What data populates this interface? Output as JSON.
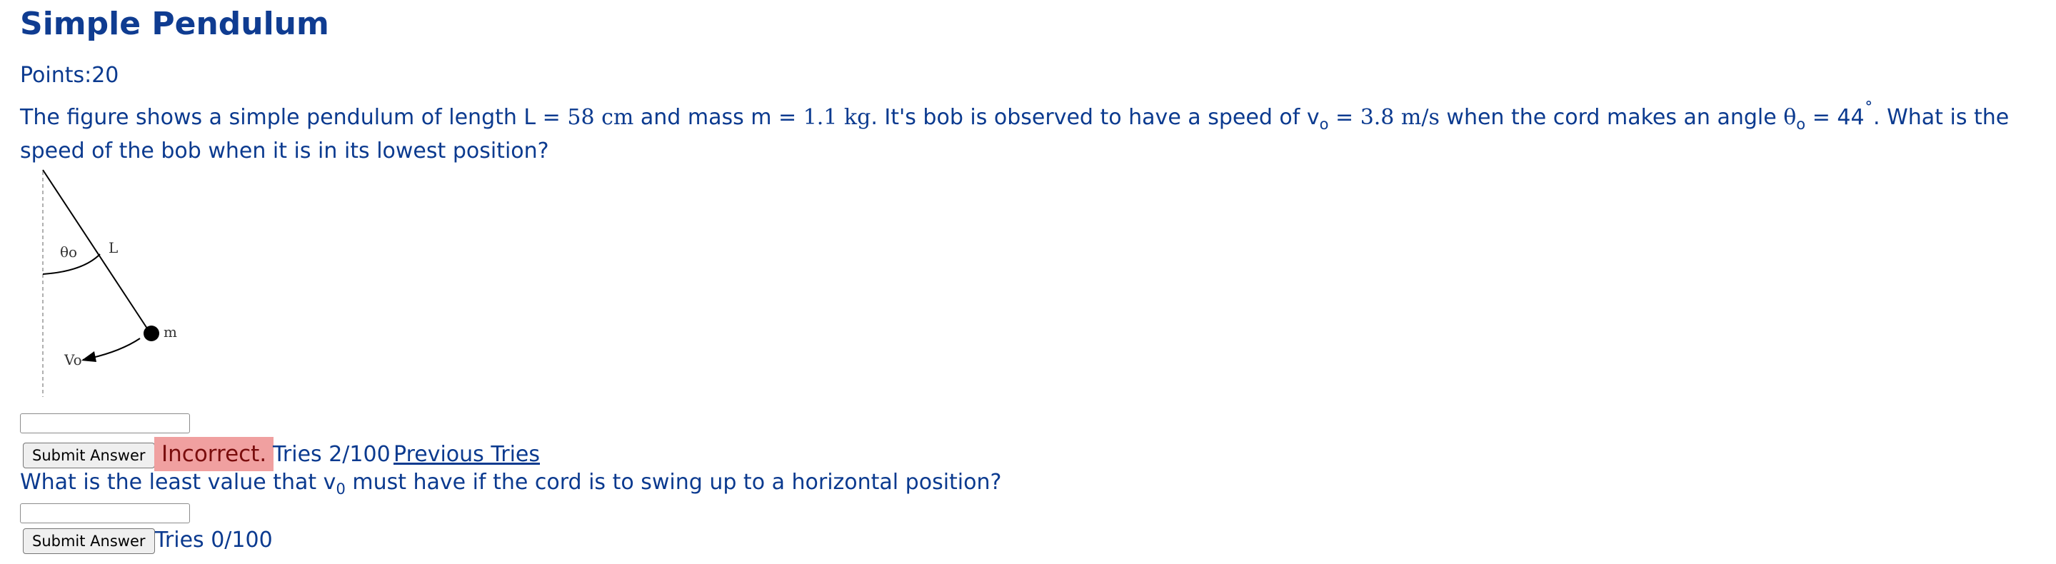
{
  "page": {
    "title": "Simple Pendulum",
    "points_label": "Points:20"
  },
  "problem1": {
    "text_a": "The figure shows a simple pendulum of length L = ",
    "length_value": "58 cm",
    "text_b": " and mass m = ",
    "mass_value": "1.1 kg",
    "text_c": ". It's bob is observed to have a speed of v",
    "v_sub": "o",
    "text_d": " = ",
    "speed_value": "3.8 m/s",
    "text_e": " when the cord makes an angle ",
    "theta_symbol": "θ",
    "theta_sub": "o",
    "text_f": " = 44",
    "degree": "˚",
    "text_g": ". What is the speed of the bob when it is in its lowest position?"
  },
  "figure": {
    "theta_label": "θo",
    "length_label": "L",
    "mass_label": "m",
    "velocity_label": "Vo"
  },
  "part1": {
    "input_value": "",
    "submit_label": "Submit Answer",
    "status": "Incorrect.",
    "tries": "Tries 2/100",
    "previous_tries_link": "Previous Tries",
    "status_color": "#f0a0a0"
  },
  "part2": {
    "question_a": "What is the least value that v",
    "question_sub": "0",
    "question_b": " must have if the cord is to swing up to a horizontal position?",
    "input_value": "",
    "submit_label": "Submit Answer",
    "tries": "Tries 0/100"
  }
}
